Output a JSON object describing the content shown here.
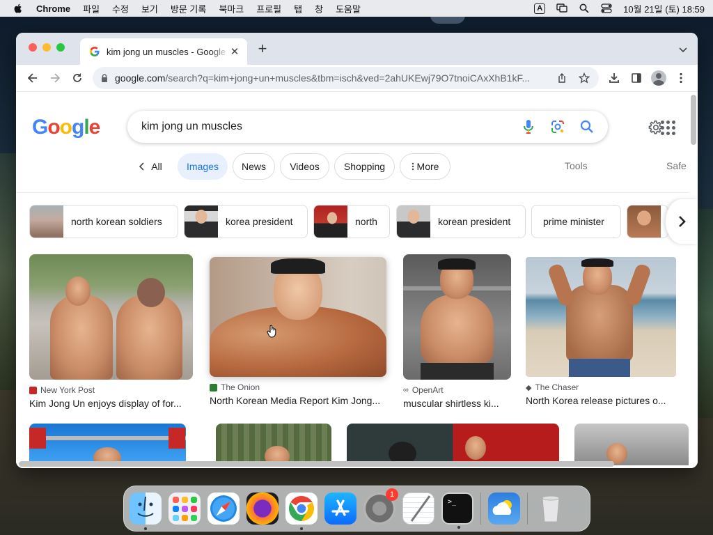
{
  "menubar": {
    "app_name": "Chrome",
    "items": [
      "파일",
      "수정",
      "보기",
      "방문 기록",
      "북마크",
      "프로필",
      "탭",
      "창",
      "도움말"
    ],
    "input_mode": "A",
    "datetime": "10월 21일 (토) 18:59"
  },
  "browser": {
    "tab_title": "kim jong un muscles - Google Search",
    "url_host": "google.com",
    "url_path": "/search?q=kim+jong+un+muscles&tbm=isch&ved=2ahUKEwj79O7tnoiCAxXhB1kF..."
  },
  "google": {
    "logo": [
      "G",
      "o",
      "o",
      "g",
      "l",
      "e"
    ],
    "query": "kim jong un muscles",
    "filters": {
      "all": "All",
      "images": "Images",
      "news": "News",
      "videos": "Videos",
      "shopping": "Shopping",
      "more": "More",
      "tools": "Tools",
      "safe": "Safe"
    },
    "related": [
      "north korean soldiers",
      "korea president",
      "north",
      "korean president",
      "prime minister"
    ],
    "results": [
      {
        "source": "New York Post",
        "title": "Kim Jong Un enjoys display of for..."
      },
      {
        "source": "The Onion",
        "title": "North Korean Media Report Kim Jong..."
      },
      {
        "source": "OpenArt",
        "title": "muscular shirtless ki..."
      },
      {
        "source": "The Chaser",
        "title": "North Korea release pictures o..."
      }
    ]
  },
  "dock": {
    "apps": [
      "Finder",
      "Launchpad",
      "Safari",
      "Firefox",
      "Google Chrome",
      "App Store",
      "System Settings",
      "TextEdit",
      "Terminal",
      "Weather",
      "Trash"
    ],
    "settings_badge": "1"
  },
  "colors": {
    "google_blue": "#4285f4",
    "chip_active_bg": "#e8f0fe",
    "chip_active_text": "#1a73e8"
  }
}
